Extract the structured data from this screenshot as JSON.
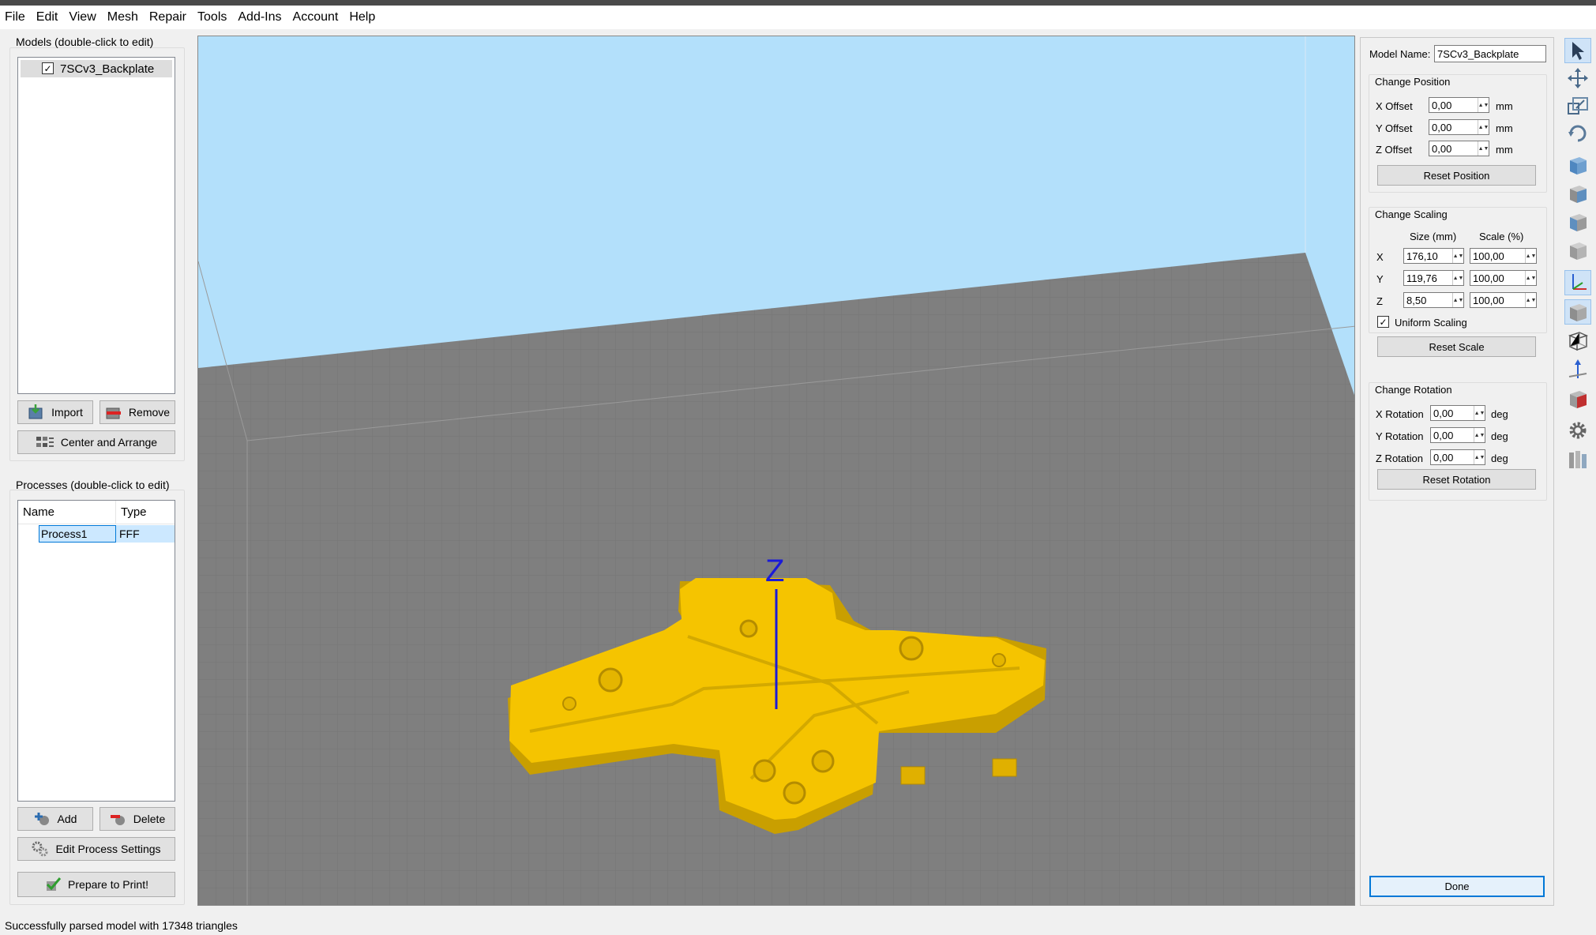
{
  "menu": [
    "File",
    "Edit",
    "View",
    "Mesh",
    "Repair",
    "Tools",
    "Add-Ins",
    "Account",
    "Help"
  ],
  "models_panel": {
    "title": "Models (double-click to edit)",
    "items": [
      {
        "label": "7SCv3_Backplate",
        "checked": true
      }
    ],
    "import_label": "Import",
    "remove_label": "Remove",
    "center_label": "Center and Arrange"
  },
  "processes_panel": {
    "title": "Processes (double-click to edit)",
    "columns": [
      "Name",
      "Type"
    ],
    "rows": [
      {
        "name": "Process1",
        "type": "FFF"
      }
    ],
    "add_label": "Add",
    "delete_label": "Delete",
    "edit_label": "Edit Process Settings",
    "prepare_label": "Prepare to Print!"
  },
  "viewport": {
    "axis_label": "Z",
    "sky_color": "#b3e0fb",
    "bed_color": "#7f7f7f",
    "model_color": "#f5c400"
  },
  "properties": {
    "model_name_label": "Model Name:",
    "model_name": "7SCv3_Backplate",
    "position": {
      "title": "Change Position",
      "rows": [
        {
          "label": "X Offset",
          "value": "0,00",
          "unit": "mm"
        },
        {
          "label": "Y Offset",
          "value": "0,00",
          "unit": "mm"
        },
        {
          "label": "Z Offset",
          "value": "0,00",
          "unit": "mm"
        }
      ],
      "reset_label": "Reset Position"
    },
    "scaling": {
      "title": "Change Scaling",
      "size_header": "Size (mm)",
      "scale_header": "Scale (%)",
      "rows": [
        {
          "axis": "X",
          "size": "176,10",
          "scale": "100,00"
        },
        {
          "axis": "Y",
          "size": "119,76",
          "scale": "100,00"
        },
        {
          "axis": "Z",
          "size": "8,50",
          "scale": "100,00"
        }
      ],
      "uniform_label": "Uniform Scaling",
      "uniform_checked": true,
      "reset_label": "Reset Scale"
    },
    "rotation": {
      "title": "Change Rotation",
      "rows": [
        {
          "label": "X Rotation",
          "value": "0,00",
          "unit": "deg"
        },
        {
          "label": "Y Rotation",
          "value": "0,00",
          "unit": "deg"
        },
        {
          "label": "Z Rotation",
          "value": "0,00",
          "unit": "deg"
        }
      ],
      "reset_label": "Reset Rotation"
    },
    "done_label": "Done"
  },
  "toolbar": [
    "select-icon",
    "move-icon",
    "scale-icon",
    "rotate-icon",
    "view-top-cube-icon",
    "view-front-cube-icon",
    "view-side-cube-icon",
    "view-iso-cube-icon",
    "axes-icon",
    "solid-cube-icon",
    "wireframe-cube-icon",
    "normal-arrow-icon",
    "cross-section-icon",
    "settings-gear-icon",
    "bed-icon"
  ],
  "status": "Successfully parsed model with 17348 triangles"
}
